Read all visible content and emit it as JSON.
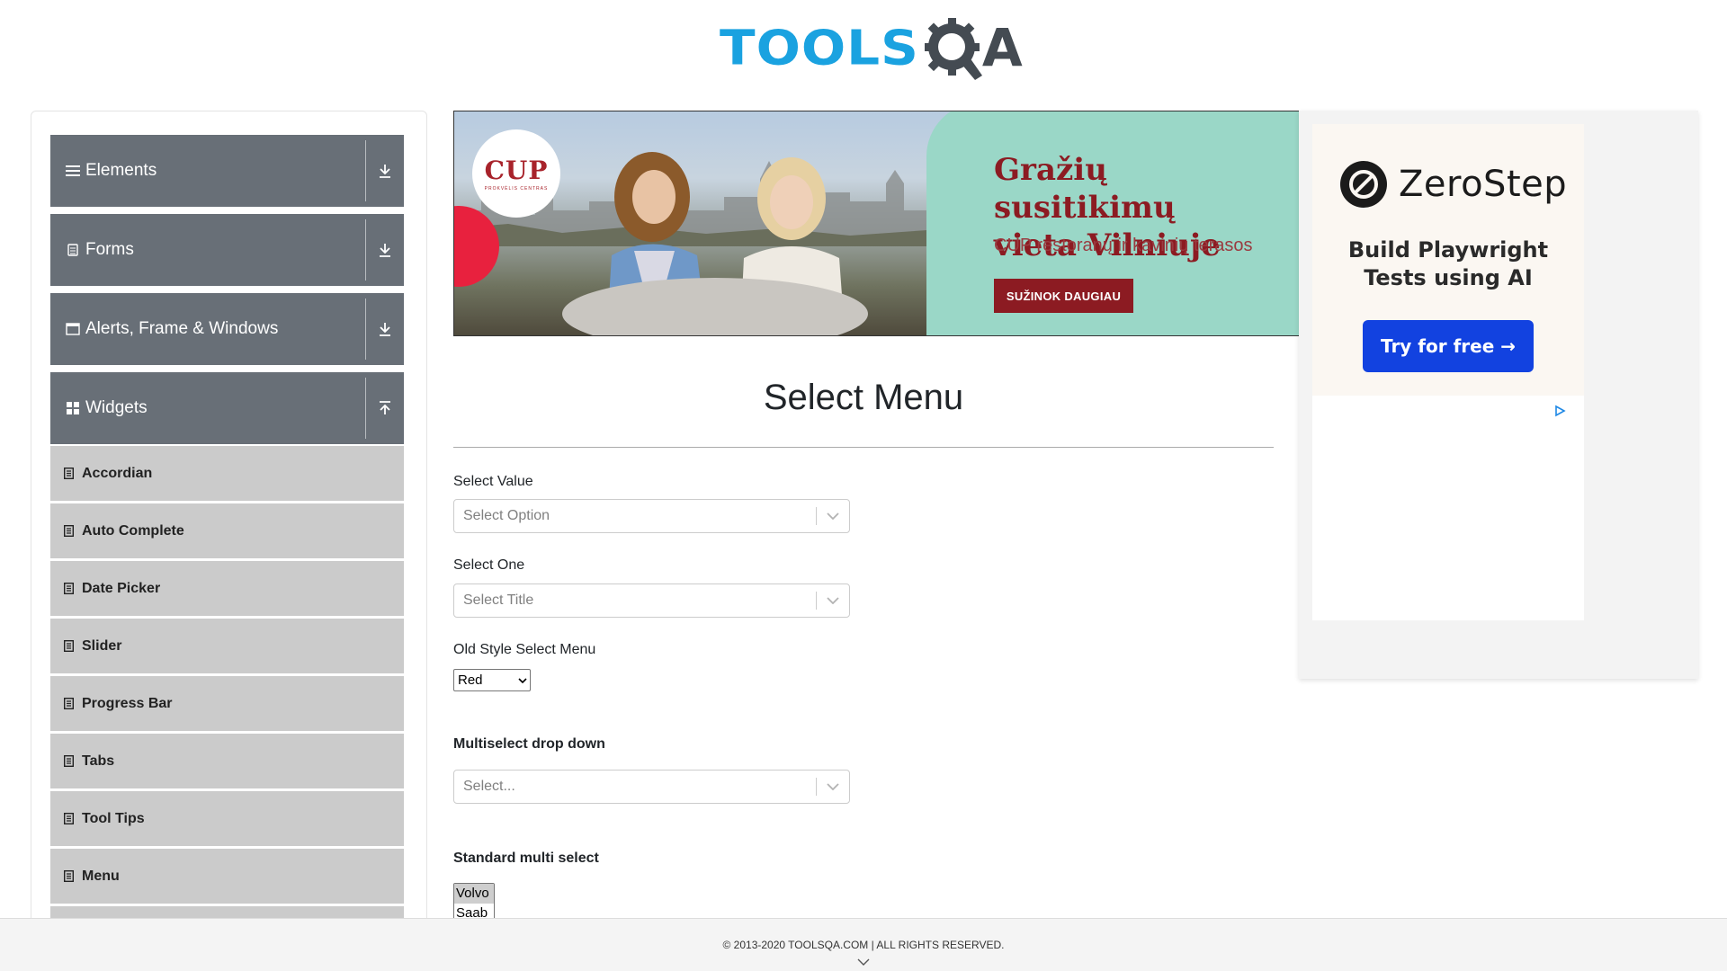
{
  "header": {
    "logo_text_blue": "TOOLS",
    "logo_text_dark": "A"
  },
  "sidebar": {
    "groups": [
      {
        "label": "Elements",
        "icon": "hamburger-icon",
        "expanded": false
      },
      {
        "label": "Forms",
        "icon": "document-icon",
        "expanded": false
      },
      {
        "label": "Alerts, Frame & Windows",
        "icon": "window-icon",
        "expanded": false
      },
      {
        "label": "Widgets",
        "icon": "grid-icon",
        "expanded": true
      }
    ],
    "items": [
      {
        "label": "Accordian"
      },
      {
        "label": "Auto Complete"
      },
      {
        "label": "Date Picker"
      },
      {
        "label": "Slider"
      },
      {
        "label": "Progress Bar"
      },
      {
        "label": "Tabs"
      },
      {
        "label": "Tool Tips"
      },
      {
        "label": "Menu"
      }
    ]
  },
  "banner_ad": {
    "brand": "CUP",
    "brand_sub": "PROKVĖLIS CENTRAS",
    "title_line1": "Gražių susitikimų",
    "title_line2": "vieta Vilniuje",
    "subtitle": "CUP restoranų ir kavinių terasos",
    "cta": "SUŽINOK DAUGIAU",
    "colors": {
      "green": "#9ad7c7",
      "maroon": "#8c1b22",
      "red": "#e8213e"
    }
  },
  "right_ad": {
    "brand": "ZeroStep",
    "tagline_line1": "Build Playwright",
    "tagline_line2": "Tests using AI",
    "cta": "Try for free →",
    "colors": {
      "button": "#1242e0"
    }
  },
  "main": {
    "title": "Select Menu",
    "select_value": {
      "label": "Select Value",
      "placeholder": "Select Option"
    },
    "select_one": {
      "label": "Select One",
      "placeholder": "Select Title"
    },
    "old_style": {
      "label": "Old Style Select Menu",
      "value": "Red"
    },
    "multiselect": {
      "label": "Multiselect drop down",
      "placeholder": "Select..."
    },
    "standard_multi": {
      "label": "Standard multi select",
      "options": [
        "Volvo",
        "Saab"
      ]
    }
  },
  "footer": {
    "text": "© 2013-2020 TOOLSQA.COM | ALL RIGHTS RESERVED."
  }
}
